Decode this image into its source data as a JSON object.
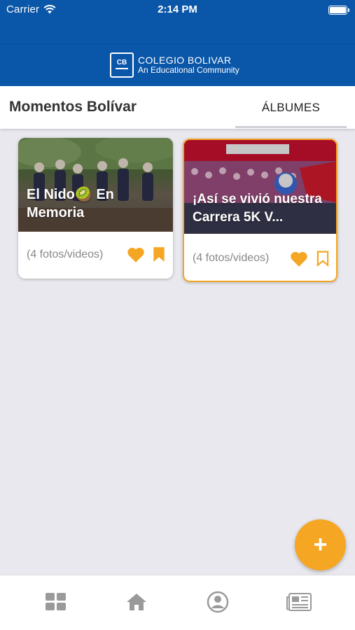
{
  "status_bar": {
    "carrier": "Carrier",
    "time": "2:14 PM"
  },
  "header": {
    "logo_name": "COLEGIO BOLIVAR",
    "logo_tagline": "An Educational Community"
  },
  "title_bar": {
    "title": "Momentos Bolívar",
    "tab_label": "ÁLBUMES"
  },
  "albums": [
    {
      "title": "El Nido🥝 En Memoria",
      "count": "(4 fotos/videos)",
      "favorited": true,
      "bookmarked": true
    },
    {
      "title": "¡Así se vivió nuestra Carrera 5K V...",
      "count": "(4 fotos/videos)",
      "favorited": true,
      "bookmarked": false
    }
  ],
  "fab": {
    "icon": "plus-icon",
    "label": "+"
  },
  "bottom_nav": {
    "items": [
      "grid-icon",
      "home-icon",
      "profile-icon",
      "newspaper-icon"
    ]
  },
  "colors": {
    "header_blue": "#0a56a8",
    "accent_orange": "#f5a623",
    "background": "#e8e8ee",
    "nav_icon_gray": "#9a9a9a"
  }
}
